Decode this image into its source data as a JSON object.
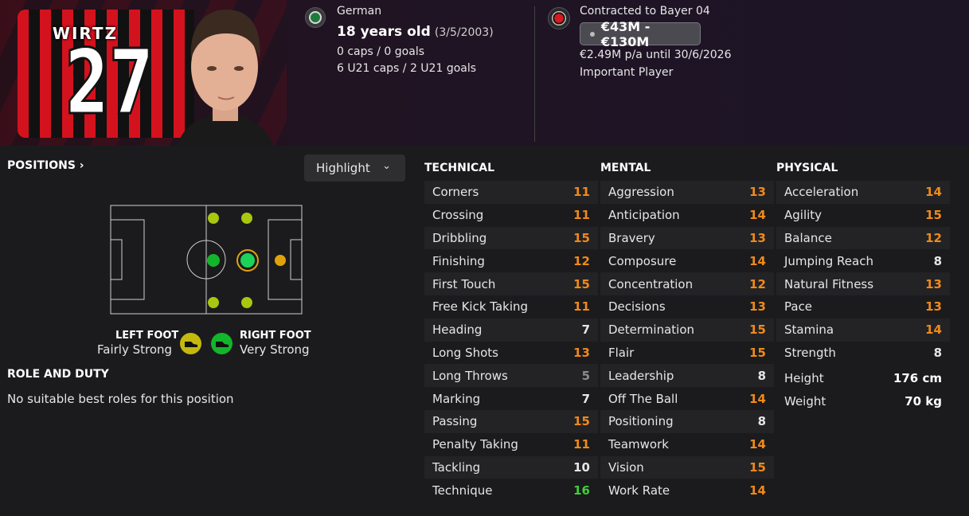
{
  "player": {
    "shirt_name": "WIRTZ",
    "shirt_number": "27"
  },
  "nationality": {
    "label": "German",
    "age": "18 years old",
    "dob": "(3/5/2003)",
    "caps": "0 caps / 0 goals",
    "u21_caps": "6 U21 caps / 2 U21 goals"
  },
  "contract": {
    "club_line": "Contracted to Bayer 04",
    "value": "€43M - €130M",
    "wage": "€2.49M p/a until 30/6/2026",
    "status": "Important Player"
  },
  "positions": {
    "title": "POSITIONS",
    "highlight_label": "Highlight",
    "left_foot_label": "LEFT FOOT",
    "left_foot_value": "Fairly Strong",
    "right_foot_label": "RIGHT FOOT",
    "right_foot_value": "Very Strong"
  },
  "role": {
    "title": "ROLE AND DUTY",
    "text": "No suitable best roles for this position"
  },
  "technical": {
    "title": "TECHNICAL",
    "rows": [
      {
        "name": "Corners",
        "value": "11",
        "color": "orange"
      },
      {
        "name": "Crossing",
        "value": "11",
        "color": "orange"
      },
      {
        "name": "Dribbling",
        "value": "15",
        "color": "orange"
      },
      {
        "name": "Finishing",
        "value": "12",
        "color": "orange"
      },
      {
        "name": "First Touch",
        "value": "15",
        "color": "orange"
      },
      {
        "name": "Free Kick Taking",
        "value": "11",
        "color": "orange"
      },
      {
        "name": "Heading",
        "value": "7",
        "color": "white"
      },
      {
        "name": "Long Shots",
        "value": "13",
        "color": "orange"
      },
      {
        "name": "Long Throws",
        "value": "5",
        "color": "grey"
      },
      {
        "name": "Marking",
        "value": "7",
        "color": "white"
      },
      {
        "name": "Passing",
        "value": "15",
        "color": "orange"
      },
      {
        "name": "Penalty Taking",
        "value": "11",
        "color": "orange"
      },
      {
        "name": "Tackling",
        "value": "10",
        "color": "white"
      },
      {
        "name": "Technique",
        "value": "16",
        "color": "green"
      }
    ]
  },
  "mental": {
    "title": "MENTAL",
    "rows": [
      {
        "name": "Aggression",
        "value": "13",
        "color": "orange"
      },
      {
        "name": "Anticipation",
        "value": "14",
        "color": "orange"
      },
      {
        "name": "Bravery",
        "value": "13",
        "color": "orange"
      },
      {
        "name": "Composure",
        "value": "14",
        "color": "orange"
      },
      {
        "name": "Concentration",
        "value": "12",
        "color": "orange"
      },
      {
        "name": "Decisions",
        "value": "13",
        "color": "orange"
      },
      {
        "name": "Determination",
        "value": "15",
        "color": "orange"
      },
      {
        "name": "Flair",
        "value": "15",
        "color": "orange"
      },
      {
        "name": "Leadership",
        "value": "8",
        "color": "white"
      },
      {
        "name": "Off The Ball",
        "value": "14",
        "color": "orange"
      },
      {
        "name": "Positioning",
        "value": "8",
        "color": "white"
      },
      {
        "name": "Teamwork",
        "value": "14",
        "color": "orange"
      },
      {
        "name": "Vision",
        "value": "15",
        "color": "orange"
      },
      {
        "name": "Work Rate",
        "value": "14",
        "color": "orange"
      }
    ]
  },
  "physical": {
    "title": "PHYSICAL",
    "rows": [
      {
        "name": "Acceleration",
        "value": "14",
        "color": "orange"
      },
      {
        "name": "Agility",
        "value": "15",
        "color": "orange"
      },
      {
        "name": "Balance",
        "value": "12",
        "color": "orange"
      },
      {
        "name": "Jumping Reach",
        "value": "8",
        "color": "white"
      },
      {
        "name": "Natural Fitness",
        "value": "13",
        "color": "orange"
      },
      {
        "name": "Pace",
        "value": "13",
        "color": "orange"
      },
      {
        "name": "Stamina",
        "value": "14",
        "color": "orange"
      },
      {
        "name": "Strength",
        "value": "8",
        "color": "white"
      }
    ],
    "height_label": "Height",
    "height_value": "176 cm",
    "weight_label": "Weight",
    "weight_value": "70 kg"
  },
  "colors": {
    "orange": "#ef8a1a",
    "white": "#e6e6e6",
    "grey": "#8c8c8c",
    "green": "#3fcf3a"
  }
}
